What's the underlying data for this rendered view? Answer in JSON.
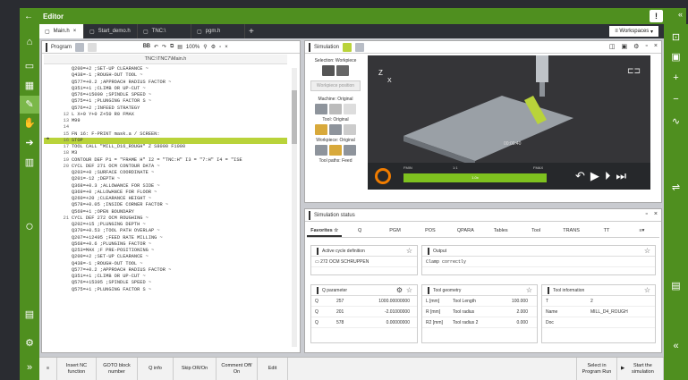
{
  "app": {
    "title": "Editor",
    "back": "←",
    "warn": "!",
    "collapse": "«"
  },
  "tabs": [
    {
      "label": "Main.h",
      "close": "×"
    },
    {
      "label": "Start_demo.h"
    },
    {
      "label": "TNC:\\"
    },
    {
      "label": "pgm.h"
    }
  ],
  "tab_plus": "+",
  "workspaces": "Workspaces",
  "program": {
    "title": "Program",
    "zoom": "100%",
    "path": "TNC:\\TNC7\\Main.h",
    "lines": [
      {
        "n": "",
        "t": "Q200=+2 ;SET-UP CLEARANCE ~"
      },
      {
        "n": "",
        "t": "Q438=-1 ;ROUGH-OUT TOOL ~"
      },
      {
        "n": "",
        "t": "Q577=+0.2 ;APPROACH RADIUS FACTOR ~"
      },
      {
        "n": "",
        "t": "Q351=+1 ;CLIMB OR UP-CUT ~"
      },
      {
        "n": "",
        "t": "Q576=+15000 ;SPINDLE SPEED ~"
      },
      {
        "n": "",
        "t": "Q575=+1 ;PLUNGING FACTOR S ~"
      },
      {
        "n": "",
        "t": "Q576=+2 ;INFEED STRATEGY"
      },
      {
        "n": "12",
        "t": "L X+0 Y+0 Z+50 R0 FMAX"
      },
      {
        "n": "13",
        "t": "M99"
      },
      {
        "n": "14",
        "t": ""
      },
      {
        "n": "15",
        "t": "FN 16: F-PRINT mask.a / SCREEN:"
      },
      {
        "n": "16",
        "t": "STOP",
        "hl": true
      },
      {
        "n": "17",
        "t": "TOOL CALL \"MILL_D16_ROUGH\" Z S8000 F1000"
      },
      {
        "n": "18",
        "t": "M3"
      },
      {
        "n": "19",
        "t": "CONTOUR DEF P1 = \"FRAME H\" I2 = \"TNC:H\" I3 = \"7:H\" I4 = \"ISE"
      },
      {
        "n": "20",
        "t": "CYCL DEF 271 OCM CONTOUR DATA ~"
      },
      {
        "n": "",
        "t": "Q203=+0 ;SURFACE COORDINATE ~"
      },
      {
        "n": "",
        "t": "Q201=-12 ;DEPTH ~"
      },
      {
        "n": "",
        "t": "Q368=+0.3 ;ALLOWANCE FOR SIDE ~"
      },
      {
        "n": "",
        "t": "Q369=+0 ;ALLOWANCE FOR FLOOR ~"
      },
      {
        "n": "",
        "t": "Q260=+20 ;CLEARANCE HEIGHT ~"
      },
      {
        "n": "",
        "t": "Q578=+0.05 ;INSIDE CORNER FACTOR ~"
      },
      {
        "n": "",
        "t": "Q569=+1 ;OPEN BOUNDARY"
      },
      {
        "n": "21",
        "t": "CYCL DEF 272 OCM ROUGHING ~"
      },
      {
        "n": "",
        "t": "Q202=+15 ;PLUNGING DEPTH ~"
      },
      {
        "n": "",
        "t": "Q370=+0.53 ;TOOL PATH OVERLAP ~"
      },
      {
        "n": "",
        "t": "Q207=+12495 ;FEED RATE MILLING ~"
      },
      {
        "n": "",
        "t": "Q568=+0.6 ;PLUNGING FACTOR ~"
      },
      {
        "n": "",
        "t": "Q253=MAX ;F PRE-POSITIONING ~"
      },
      {
        "n": "",
        "t": "Q200=+2 ;SET-UP CLEARANCE ~"
      },
      {
        "n": "",
        "t": "Q438=-1 ;ROUGH-OUT TOOL ~"
      },
      {
        "n": "",
        "t": "Q577=+0.2 ;APPROACH RADIUS FACTOR ~"
      },
      {
        "n": "",
        "t": "Q351=+1 ;CLIMB OR UP-CUT ~"
      },
      {
        "n": "",
        "t": "Q576=+15395 ;SPINDLE SPEED ~"
      },
      {
        "n": "",
        "t": "Q575=+1 ;PLUNGING FACTOR S ~"
      }
    ]
  },
  "simulation": {
    "title": "Simulation",
    "selection_label": "Selection: Workpiece",
    "workpiece_btn": "Workpiece position",
    "machine_label": "Machine: Original",
    "tool_label": "Tool: Original",
    "wp_label": "Workpiece: Original",
    "paths_label": "Tool paths: Feed",
    "time": "00:00:40",
    "fmin": "FMIN",
    "fmax": "FMAX",
    "speed": "1:1",
    "speed_val": "1.0x"
  },
  "status": {
    "title": "Simulation status",
    "tabs": [
      "Favorites",
      "Q",
      "PGM",
      "POS",
      "QPARA",
      "Tables",
      "Tool",
      "TRANS",
      "TT"
    ],
    "active_cycle": {
      "title": "Active cycle definition",
      "value": "272 OCM SCHRUPPEN"
    },
    "output": {
      "title": "Output",
      "value": "Clamp correctly"
    },
    "qparams": {
      "title": "Q parameter",
      "rows": [
        [
          "Q",
          "257",
          "1000.00000000"
        ],
        [
          "Q",
          "201",
          "-2.01000000"
        ],
        [
          "Q",
          "578",
          "0.00000000"
        ]
      ]
    },
    "geometry": {
      "title": "Tool geometry",
      "rows": [
        [
          "L [mm]",
          "Tool Length",
          "100.000"
        ],
        [
          "R [mm]",
          "Tool radius",
          "2.000"
        ],
        [
          "R2 [mm]",
          "Tool radius 2",
          "0.000"
        ]
      ]
    },
    "toolinfo": {
      "title": "Tool information",
      "rows": [
        [
          "T",
          "",
          "2"
        ],
        [
          "Name",
          "",
          "MILL_D4_ROUGH"
        ],
        [
          "Doc",
          "",
          ""
        ]
      ]
    }
  },
  "bottom": {
    "insert": "Insert NC function",
    "goto": "GOTO block number",
    "qinfo": "Q info",
    "skip": "Skip OR/On",
    "comment": "Comment Off/ On",
    "edit": "Edit",
    "select": "Select in Program Run",
    "start": "Start the simulation"
  },
  "colors": {
    "accent": "#4f8f1f",
    "highlight": "#b9d33a",
    "sim_bar": "#7ec21f",
    "cycle_btn": "#f07c00"
  }
}
